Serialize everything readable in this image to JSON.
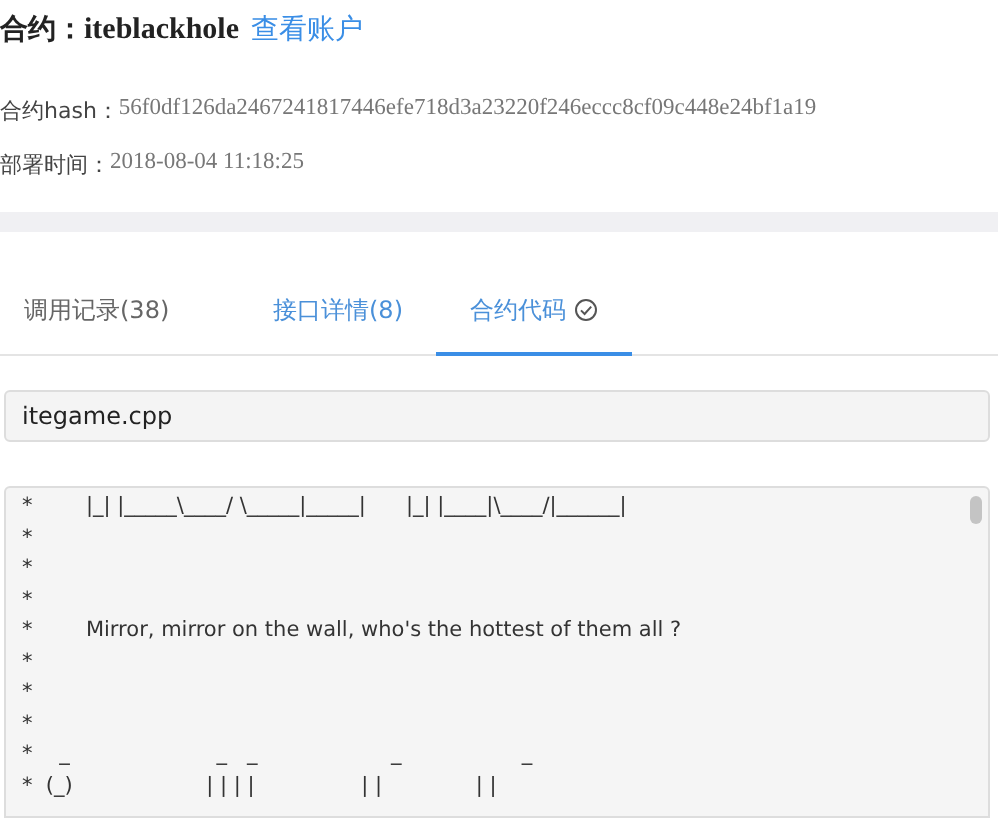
{
  "contract": {
    "label": "合约：",
    "name": "iteblackhole",
    "link": "查看账户"
  },
  "info": [
    {
      "label": "合约hash：",
      "value": "56f0df126da2467241817446efe718d3a23220f246eccc8cf09c448e24bf1a19"
    },
    {
      "label": "部署时间：",
      "value": "2018-08-04 11:18:25"
    }
  ],
  "tabs": [
    {
      "label": "调用记录(38)",
      "selected": false,
      "verified": false
    },
    {
      "label": "接口详情(8)",
      "selected": false,
      "verified": false
    },
    {
      "label": "合约代码",
      "selected": true,
      "verified": true
    }
  ],
  "file": {
    "value": "itegame.cpp"
  },
  "code_lines": [
    "*        |_| |_____\\____/ \\_____|_____|      |_| |____|\\____/|______|",
    "*",
    "*",
    "*",
    "*        Mirror, mirror on the wall, who's the hottest of them all ?",
    "*",
    "*",
    "*",
    "*    _                      _   _                    _                  _",
    "*  (_)                    | | | |                | |              | |"
  ]
}
